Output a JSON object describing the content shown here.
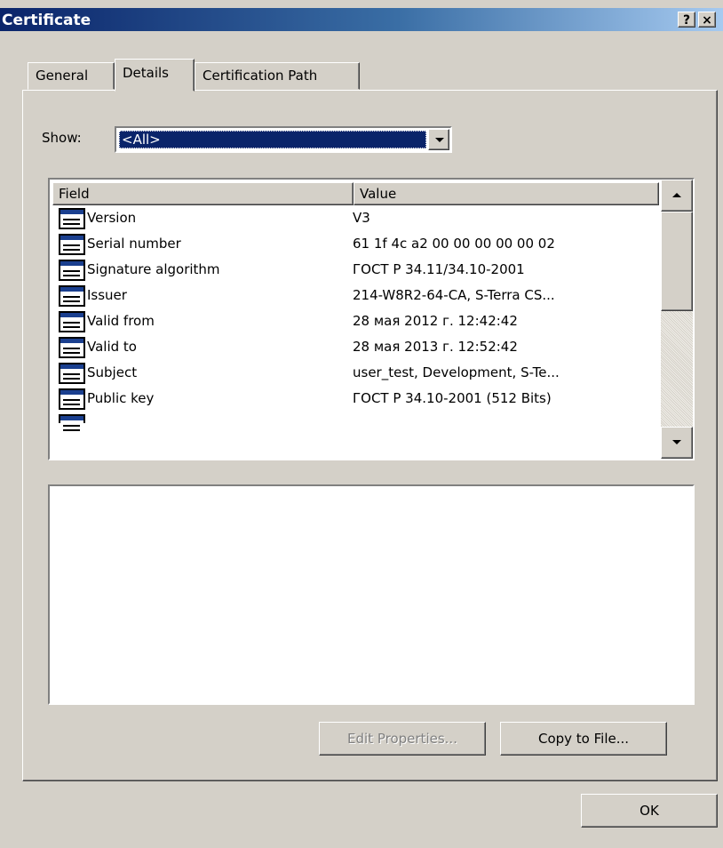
{
  "window": {
    "title": "Certificate",
    "help_label": "?",
    "close_label": "×"
  },
  "tabs": [
    {
      "label": "General"
    },
    {
      "label": "Details"
    },
    {
      "label": "Certification Path"
    }
  ],
  "show": {
    "label": "Show:",
    "value": "<All>"
  },
  "list": {
    "columns": {
      "field": "Field",
      "value": "Value"
    },
    "rows": [
      {
        "field": "Version",
        "value": "V3"
      },
      {
        "field": "Serial number",
        "value": "61 1f 4c a2 00 00 00 00 00 02"
      },
      {
        "field": "Signature algorithm",
        "value": "ГОСТ Р 34.11/34.10-2001"
      },
      {
        "field": "Issuer",
        "value": "214-W8R2-64-CA, S-Terra CS..."
      },
      {
        "field": "Valid from",
        "value": "28 мая 2012 г. 12:42:42"
      },
      {
        "field": "Valid to",
        "value": "28 мая 2013 г. 12:52:42"
      },
      {
        "field": "Subject",
        "value": "user_test, Development, S-Te..."
      },
      {
        "field": "Public key",
        "value": "ГОСТ Р 34.10-2001 (512 Bits)"
      }
    ]
  },
  "buttons": {
    "edit_properties": "Edit Properties...",
    "copy_to_file": "Copy to File...",
    "ok": "OK"
  },
  "colors": {
    "title_bar": "#0a246a",
    "selection": "#0a246a",
    "face": "#d4d0c8"
  }
}
